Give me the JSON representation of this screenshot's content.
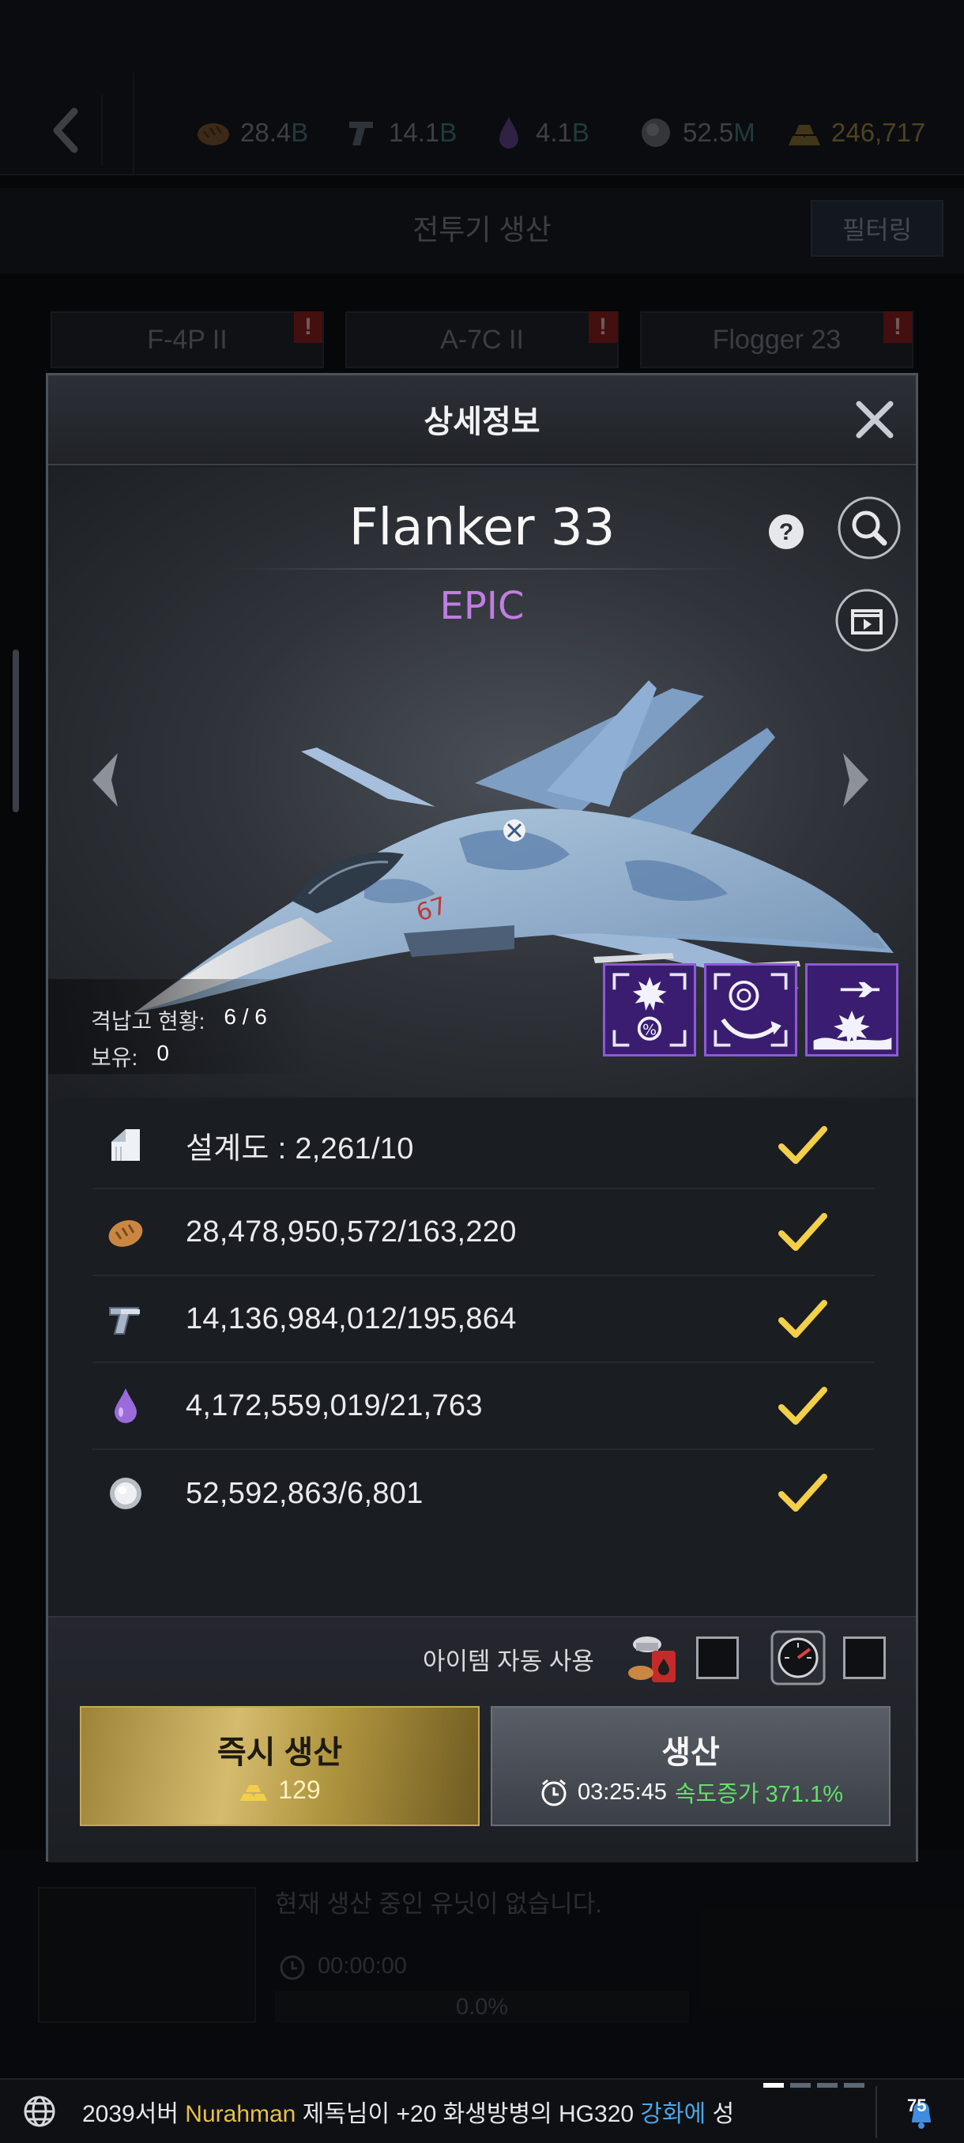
{
  "top_bar": {
    "resources": [
      {
        "icon": "bread-icon",
        "value": "28.4",
        "unit": "B"
      },
      {
        "icon": "steel-beam-icon",
        "value": "14.1",
        "unit": "B"
      },
      {
        "icon": "oil-drop-icon",
        "value": "4.1",
        "unit": "B"
      },
      {
        "icon": "mineral-orb-icon",
        "value": "52.5",
        "unit": "M"
      },
      {
        "icon": "gold-bars-icon",
        "value": "246,717",
        "unit": ""
      }
    ]
  },
  "page": {
    "title": "전투기 생산",
    "filter_label": "필터링",
    "tabs": [
      "F-4P II",
      "A-7C II",
      "Flogger 23"
    ],
    "alert_mark": "!"
  },
  "modal": {
    "title": "상세정보",
    "unit_name": "Flanker 33",
    "rarity": "EPIC",
    "rarity_color": "#c07ee0",
    "hangar_label": "격납고 현황:",
    "hangar_value": "6 / 6",
    "owned_label": "보유:",
    "owned_value": "0",
    "skills": [
      "explosion-discount-skill-icon",
      "radar-evade-skill-icon",
      "air-strike-skill-icon"
    ],
    "requirements": [
      {
        "icon": "blueprint-icon",
        "text": "설계도 : 2,261/10",
        "met": true
      },
      {
        "icon": "bread-icon",
        "text": "28,478,950,572/163,220",
        "met": true
      },
      {
        "icon": "steel-beam-icon",
        "text": "14,136,984,012/195,864",
        "met": true
      },
      {
        "icon": "oil-drop-icon",
        "text": "4,172,559,019/21,763",
        "met": true
      },
      {
        "icon": "mineral-orb-icon",
        "text": "52,592,863/6,801",
        "met": true
      }
    ],
    "auto_use_label": "아이템 자동 사용",
    "instant_button": {
      "label": "즉시 생산",
      "cost": "129"
    },
    "produce_button": {
      "label": "생산",
      "time": "03:25:45",
      "boost": "속도증가 371.1%"
    }
  },
  "production": {
    "empty_text": "현재 생산 중인 유닛이 없습니다.",
    "timer": "00:00:00",
    "progress": "0.0%"
  },
  "ticker": {
    "prefix": "2039서버",
    "name": "Nurahman",
    "middle": "제독님이 +20 화생방병의 HG320",
    "highlight": "강화에",
    "suffix": "성",
    "badge": "75"
  },
  "colors": {
    "gold": "#e8bf4b",
    "check": "#f3cf4a",
    "boost": "#63e06a"
  }
}
